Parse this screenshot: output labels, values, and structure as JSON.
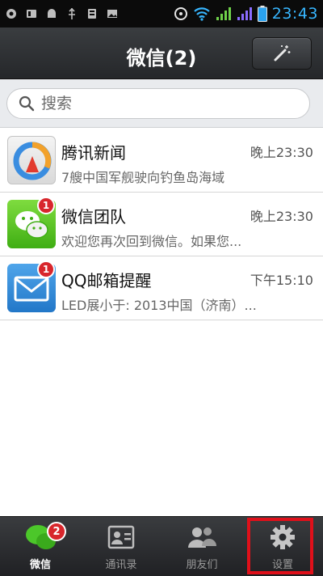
{
  "status_bar": {
    "time": "23:43"
  },
  "header": {
    "title": "微信(2)"
  },
  "search": {
    "placeholder": "搜索"
  },
  "chats": [
    {
      "name": "腾讯新闻",
      "time": "晚上23:30",
      "preview": "7艘中国军舰驶向钓鱼岛海域",
      "badge": ""
    },
    {
      "name": "微信团队",
      "time": "晚上23:30",
      "preview": "欢迎您再次回到微信。如果您...",
      "badge": "1"
    },
    {
      "name": "QQ邮箱提醒",
      "time": "下午15:10",
      "preview": "LED展小于: 2013中国（济南）...",
      "badge": "1"
    }
  ],
  "tabs": [
    {
      "label": "微信",
      "badge": "2",
      "active": true
    },
    {
      "label": "通讯录"
    },
    {
      "label": "朋友们"
    },
    {
      "label": "设置"
    }
  ],
  "colors": {
    "accent_clock": "#37b6ff",
    "badge": "#d8262c",
    "highlight": "#e0101a"
  }
}
